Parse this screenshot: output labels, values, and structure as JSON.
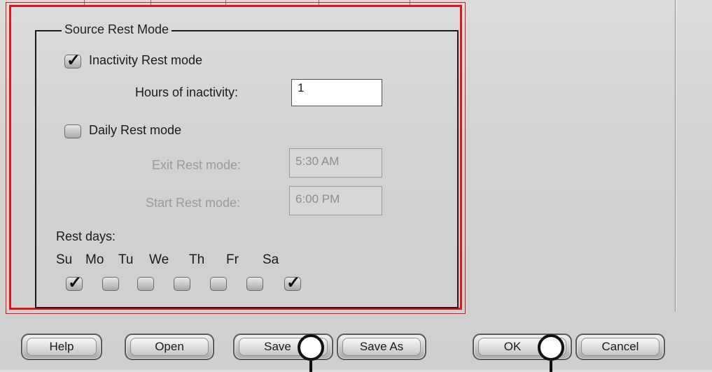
{
  "group": {
    "title": "Source Rest Mode"
  },
  "inactivity": {
    "label": "Inactivity Rest mode",
    "checked": true,
    "hours_label": "Hours of inactivity:",
    "hours_value": "1"
  },
  "daily": {
    "label": "Daily Rest mode",
    "checked": false,
    "exit_label": "Exit Rest mode:",
    "exit_value": "5:30 AM",
    "start_label": "Start Rest mode:",
    "start_value": "6:00 PM"
  },
  "rest_days": {
    "label": "Rest days:",
    "days": [
      {
        "label": "Su",
        "checked": true
      },
      {
        "label": "Mo",
        "checked": false
      },
      {
        "label": "Tu",
        "checked": false
      },
      {
        "label": "We",
        "checked": false
      },
      {
        "label": "Th",
        "checked": false
      },
      {
        "label": "Fr",
        "checked": false
      },
      {
        "label": "Sa",
        "checked": true
      }
    ]
  },
  "buttons": {
    "help": "Help",
    "open": "Open",
    "save": "Save",
    "save_as": "Save As",
    "ok": "OK",
    "cancel": "Cancel"
  },
  "colors": {
    "highlight": "#e0141b"
  },
  "icons": {
    "check": "check-icon",
    "callout": "callout-circle-icon"
  }
}
